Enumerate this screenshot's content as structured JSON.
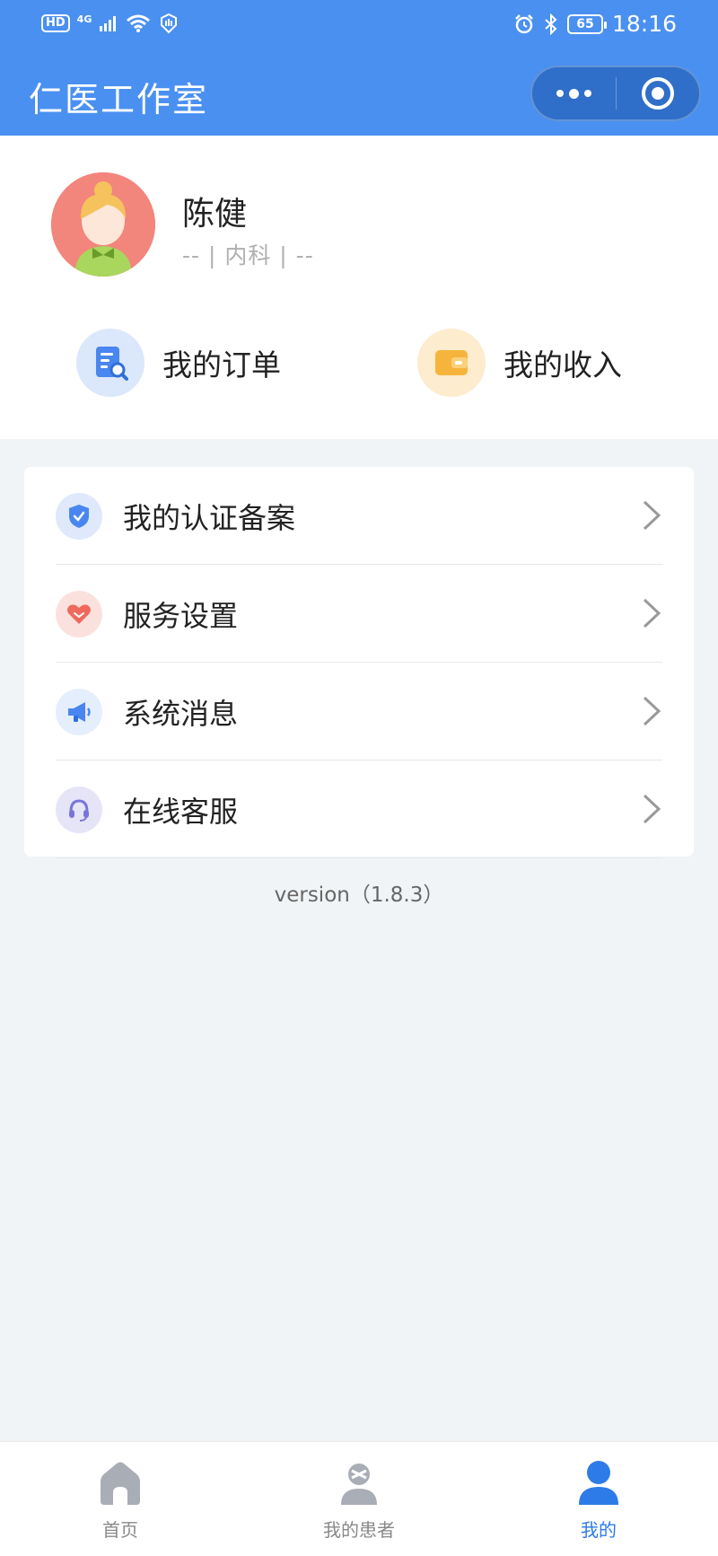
{
  "status_bar": {
    "hd": "HD",
    "network": "4G",
    "battery": "65",
    "time": "18:16"
  },
  "header": {
    "title": "仁医工作室"
  },
  "profile": {
    "name": "陈健",
    "subtitle": "-- | 内科 | --"
  },
  "quick_actions": [
    {
      "label": "我的订单",
      "icon": "order-search-icon",
      "color": "#4a86ef"
    },
    {
      "label": "我的收入",
      "icon": "wallet-icon",
      "color": "#f6b43c"
    }
  ],
  "menu": {
    "items": [
      {
        "label": "我的认证备案",
        "icon": "shield-check-icon",
        "color": "#4a86ef"
      },
      {
        "label": "服务设置",
        "icon": "heart-icon",
        "color": "#ef6a5d"
      },
      {
        "label": "系统消息",
        "icon": "megaphone-icon",
        "color": "#4a86ef"
      },
      {
        "label": "在线客服",
        "icon": "headset-icon",
        "color": "#7a75d9"
      }
    ]
  },
  "version": "version（1.8.3）",
  "tabbar": {
    "active_index": 2,
    "tabs": [
      {
        "label": "首页",
        "icon": "home-icon"
      },
      {
        "label": "我的患者",
        "icon": "patients-icon"
      },
      {
        "label": "我的",
        "icon": "person-icon"
      }
    ]
  },
  "colors": {
    "primary": "#4a90f1",
    "tab_active": "#2d7be8",
    "background": "#f1f4f6"
  }
}
